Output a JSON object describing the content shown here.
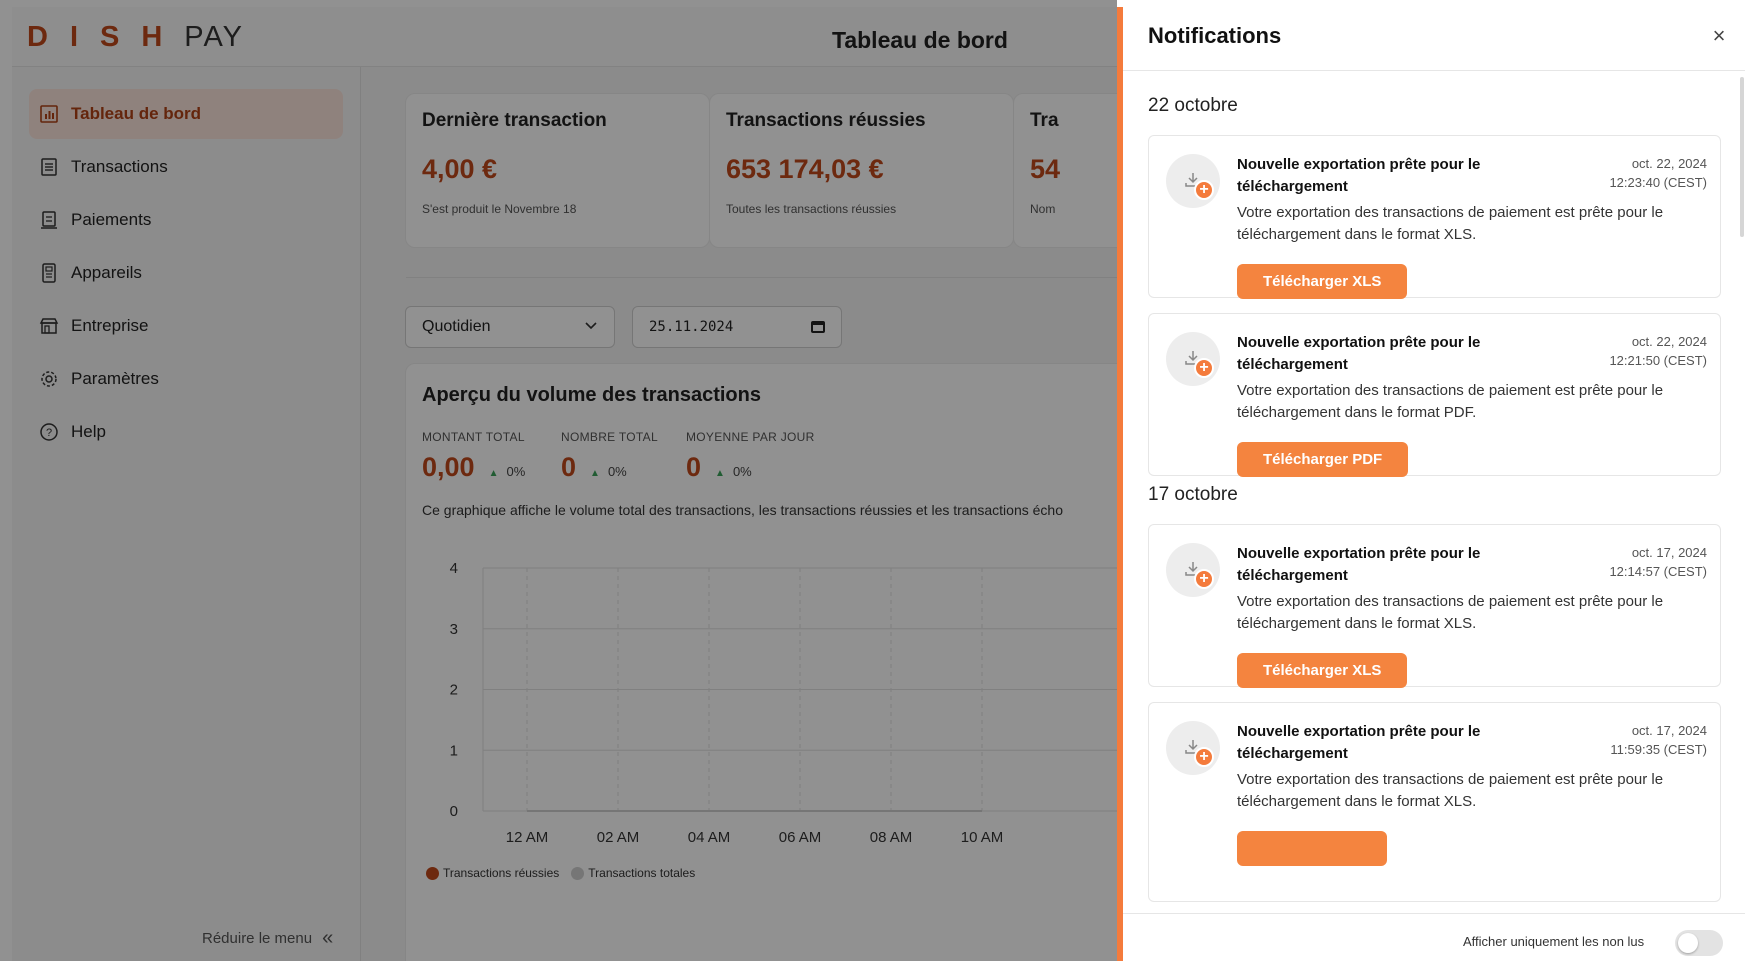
{
  "header": {
    "logo_strong": "DISH",
    "logo_light": "PAY",
    "page_title": "Tableau de bord"
  },
  "sidebar": {
    "items": [
      {
        "label": "Tableau de bord",
        "icon": "chart-icon",
        "active": true
      },
      {
        "label": "Transactions",
        "icon": "receipt-icon"
      },
      {
        "label": "Paiements",
        "icon": "payments-icon"
      },
      {
        "label": "Appareils",
        "icon": "device-icon"
      },
      {
        "label": "Entreprise",
        "icon": "store-icon"
      },
      {
        "label": "Paramètres",
        "icon": "gear-icon"
      },
      {
        "label": "Help",
        "icon": "help-icon"
      }
    ],
    "collapse_label": "Réduire le menu",
    "collapse_icon": "«"
  },
  "stats": [
    {
      "title": "Dernière transaction",
      "value": "4,00 €",
      "sub": "S'est produit le Novembre 18"
    },
    {
      "title": "Transactions réussies",
      "value": "653 174,03 €",
      "sub": "Toutes les transactions réussies"
    },
    {
      "title": "Tra",
      "value": "54",
      "sub": "Nom"
    }
  ],
  "filters": {
    "period": "Quotidien",
    "date": "25.11.2024"
  },
  "volume": {
    "title": "Aperçu du volume des transactions",
    "metrics": [
      {
        "label": "MONTANT TOTAL",
        "value": "0,00",
        "pct": "0%"
      },
      {
        "label": "NOMBRE TOTAL",
        "value": "0",
        "pct": "0%"
      },
      {
        "label": "MOYENNE PAR JOUR",
        "value": "0",
        "pct": "0%"
      }
    ],
    "description": "Ce graphique affiche le volume total des transactions, les transactions réussies et les transactions écho",
    "legend": [
      {
        "label": "Transactions réussies",
        "color": "#c0491b"
      },
      {
        "label": "Transactions totales",
        "color": "#cfcfcf"
      }
    ]
  },
  "chart_data": {
    "type": "line",
    "x": [
      "12 AM",
      "02 AM",
      "04 AM",
      "06 AM",
      "08 AM",
      "10 AM"
    ],
    "yticks": [
      0,
      1,
      2,
      3,
      4
    ],
    "ylim": [
      0,
      4
    ],
    "series": [
      {
        "name": "Transactions réussies",
        "values": [
          0,
          0,
          0,
          0,
          0,
          0
        ]
      },
      {
        "name": "Transactions totales",
        "values": [
          0,
          0,
          0,
          0,
          0,
          0
        ]
      }
    ],
    "grid": true,
    "legend": "bottom-left"
  },
  "notifications": {
    "title": "Notifications",
    "close": "×",
    "groups": [
      {
        "day": "22 octobre",
        "items": [
          {
            "title": "Nouvelle exportation prête pour le téléchargement",
            "date": "oct. 22, 2024",
            "time": "12:23:40 (CEST)",
            "body": "Votre exportation des transactions de paiement est prête pour le téléchargement dans le format XLS.",
            "button": "Télécharger XLS"
          },
          {
            "title": "Nouvelle exportation prête pour le téléchargement",
            "date": "oct. 22, 2024",
            "time": "12:21:50 (CEST)",
            "body": "Votre exportation des transactions de paiement est prête pour le téléchargement dans le format PDF.",
            "button": "Télécharger PDF"
          }
        ]
      },
      {
        "day": "17 octobre",
        "items": [
          {
            "title": "Nouvelle exportation prête pour le téléchargement",
            "date": "oct. 17, 2024",
            "time": "12:14:57 (CEST)",
            "body": "Votre exportation des transactions de paiement est prête pour le téléchargement dans le format XLS.",
            "button": "Télécharger XLS"
          },
          {
            "title": "Nouvelle exportation prête pour le téléchargement",
            "date": "oct. 17, 2024",
            "time": "11:59:35 (CEST)",
            "body": "Votre exportation des transactions de paiement est prête pour le téléchargement dans le format XLS.",
            "button": ""
          }
        ]
      }
    ],
    "footer_label": "Afficher uniquement les non lus",
    "unread_only": false
  }
}
